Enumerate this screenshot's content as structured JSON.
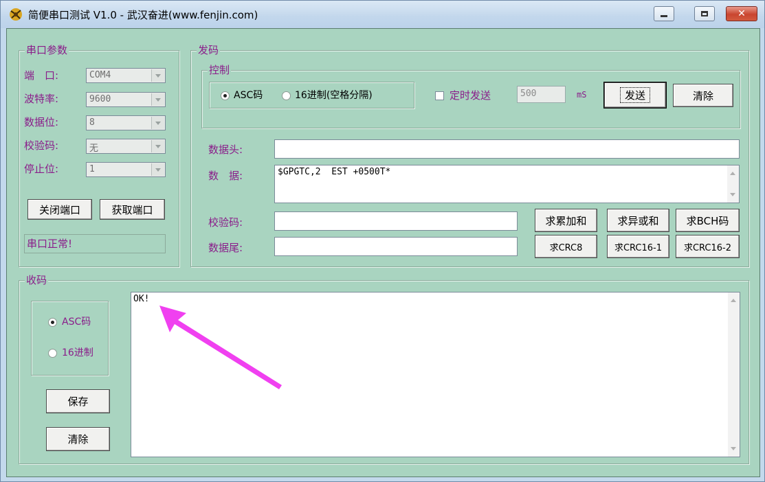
{
  "window": {
    "title": "简便串口测试 V1.0 - 武汉奋进(www.fenjin.com)",
    "min_icon": "minimize-icon",
    "max_icon": "maximize-icon",
    "close_icon": "close-icon"
  },
  "port_params": {
    "group_label": "串口参数",
    "fields": [
      {
        "label": "端　口:",
        "value": "COM4"
      },
      {
        "label": "波特率:",
        "value": "9600"
      },
      {
        "label": "数据位:",
        "value": "8"
      },
      {
        "label": "校验码:",
        "value": "无"
      },
      {
        "label": "停止位:",
        "value": "1"
      }
    ],
    "close_port_label": "关闭端口",
    "get_port_label": "获取端口",
    "status_text": "串口正常!"
  },
  "send": {
    "group_label": "发码",
    "control": {
      "group_label": "控制",
      "mode_asc_label": "ASC码",
      "mode_hex_label": "16进制(空格分隔)",
      "mode_selected": "ASC码",
      "timed_send_label": "定时发送",
      "timed_send_checked": false,
      "interval_value": "500",
      "interval_unit": "mS",
      "send_label": "发送",
      "clear_label": "清除"
    },
    "header_label": "数据头:",
    "header_value": "",
    "data_label": "数　据:",
    "data_value": "$GPGTC,2  EST +0500T*",
    "checksum_label": "校验码:",
    "checksum_value": "",
    "trailer_label": "数据尾:",
    "trailer_value": "",
    "calc_buttons": [
      "求累加和",
      "求异或和",
      "求BCH码",
      "求CRC8",
      "求CRC16-1",
      "求CRC16-2"
    ]
  },
  "receive": {
    "group_label": "收码",
    "mode_asc_label": "ASC码",
    "mode_hex_label": "16进制",
    "mode_selected": "ASC码",
    "save_label": "保存",
    "clear_label": "清除",
    "text": "OK!"
  },
  "annotation": {
    "arrow_color": "#f040f0"
  }
}
